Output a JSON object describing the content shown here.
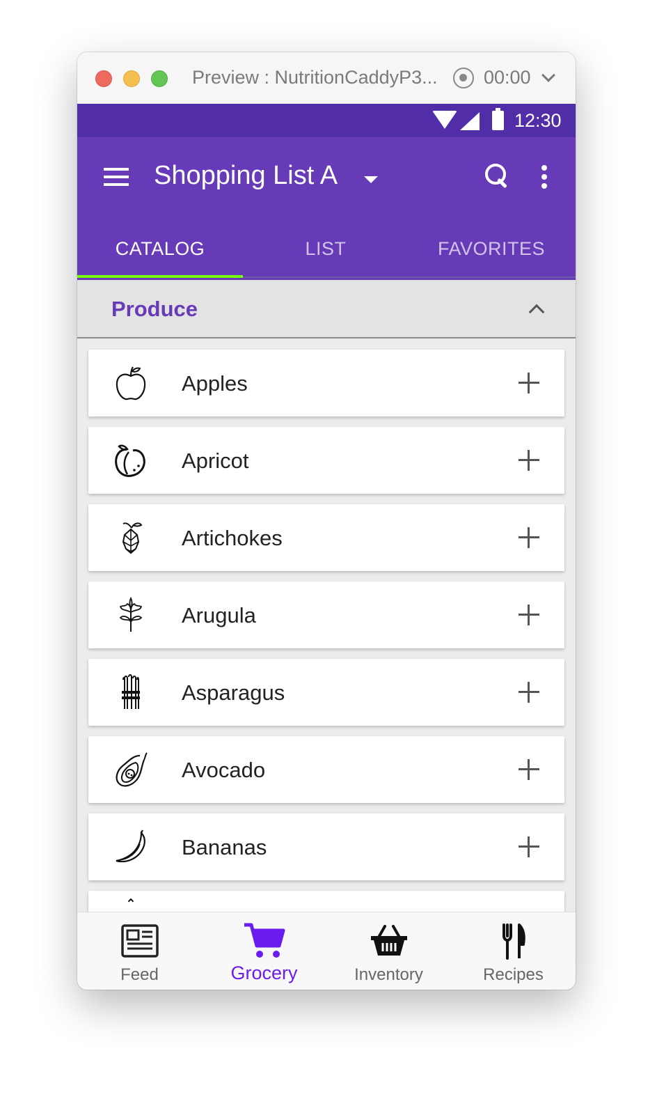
{
  "window": {
    "title": "Preview : NutritionCaddyP3...",
    "timer": "00:00"
  },
  "statusbar": {
    "time": "12:30"
  },
  "appbar": {
    "title": "Shopping List A",
    "tabs": [
      {
        "label": "CATALOG",
        "active": true
      },
      {
        "label": "LIST",
        "active": false
      },
      {
        "label": "FAVORITES",
        "active": false
      }
    ]
  },
  "section": {
    "title": "Produce"
  },
  "items": [
    {
      "label": "Apples",
      "icon": "apple-icon"
    },
    {
      "label": "Apricot",
      "icon": "apricot-icon"
    },
    {
      "label": "Artichokes",
      "icon": "artichoke-icon"
    },
    {
      "label": "Arugula",
      "icon": "arugula-icon"
    },
    {
      "label": "Asparagus",
      "icon": "asparagus-icon"
    },
    {
      "label": "Avocado",
      "icon": "avocado-icon"
    },
    {
      "label": "Bananas",
      "icon": "banana-icon"
    }
  ],
  "bottom_nav": [
    {
      "label": "Feed",
      "icon": "newspaper-icon",
      "active": false
    },
    {
      "label": "Grocery",
      "icon": "cart-icon",
      "active": true
    },
    {
      "label": "Inventory",
      "icon": "basket-icon",
      "active": false
    },
    {
      "label": "Recipes",
      "icon": "utensils-icon",
      "active": false
    }
  ],
  "colors": {
    "primary": "#673ab7",
    "primary_dark": "#512da8",
    "tab_indicator": "#76ff03",
    "nav_active": "#6a1bf0"
  }
}
